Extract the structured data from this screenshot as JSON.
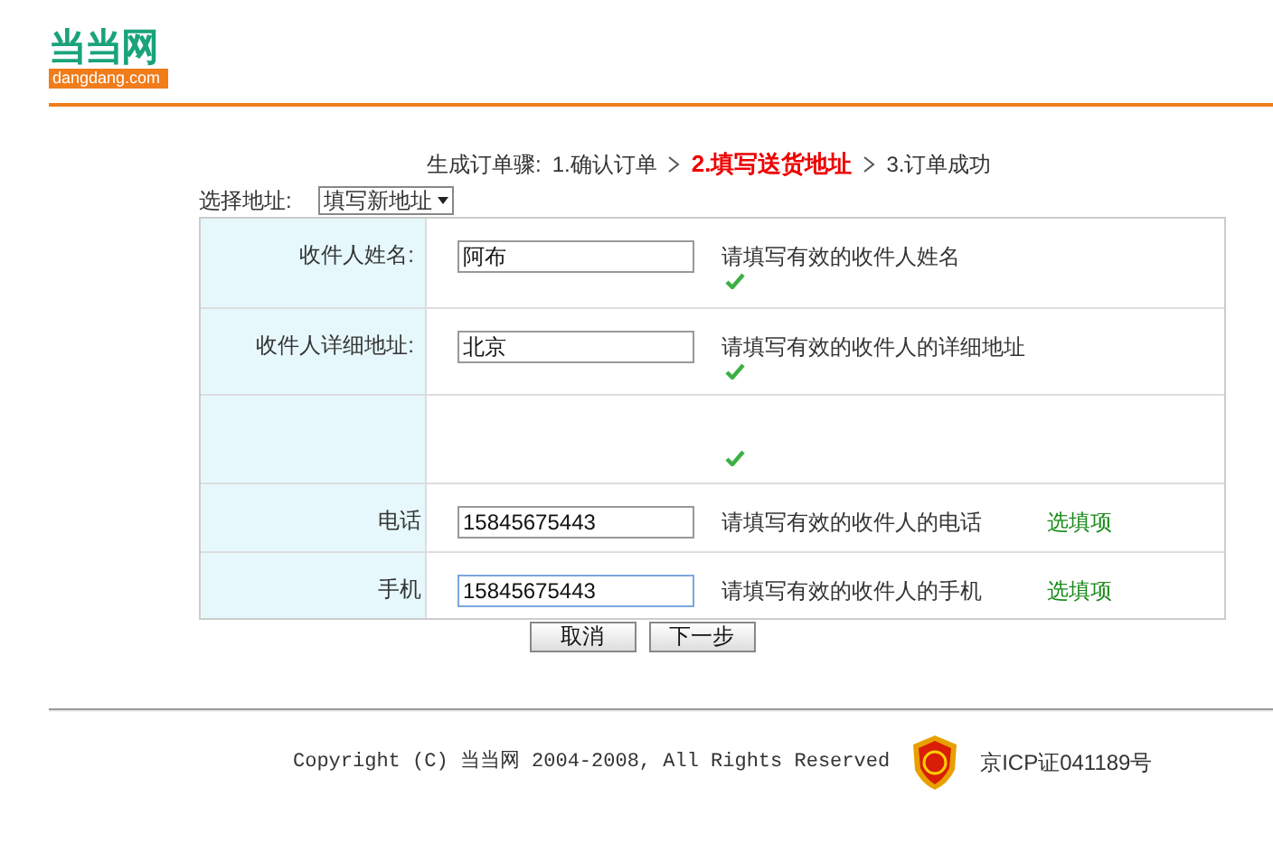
{
  "logo": {
    "name": "当当网",
    "domain": "dangdang.com"
  },
  "steps": {
    "prefix": "生成订单骤:",
    "items": [
      {
        "text": "1.确认订单",
        "selected": false
      },
      {
        "text": "2.填写送货地址",
        "selected": true
      },
      {
        "text": "3.订单成功",
        "selected": false
      }
    ]
  },
  "address_select": {
    "label": "选择地址:",
    "value": "填写新地址"
  },
  "rows": [
    {
      "label": "收件人姓名:",
      "value": "阿布",
      "hint": "请填写有效的收件人姓名",
      "valid": true,
      "focused": false
    },
    {
      "label": "收件人详细地址:",
      "value": "北京",
      "hint": "请填写有效的收件人的详细地址",
      "valid": true,
      "focused": false
    },
    {
      "valid": true
    },
    {
      "label": "电话",
      "value": "15845675443",
      "hint": "请填写有效的收件人的电话",
      "optional": "选填项",
      "focused": false
    },
    {
      "label": "手机",
      "value": "15845675443",
      "hint": "请填写有效的收件人的手机",
      "optional": "选填项",
      "focused": true
    }
  ],
  "buttons": [
    "取消",
    "下一步"
  ],
  "footer": {
    "copyright": "Copyright (C) 当当网 2004-2008, All Rights Reserved",
    "license": "京ICP证041189号"
  }
}
